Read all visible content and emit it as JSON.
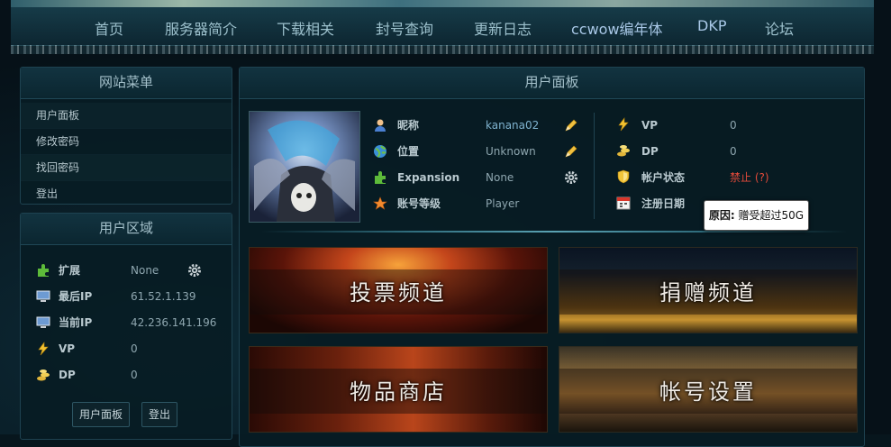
{
  "nav": [
    "首页",
    "服务器简介",
    "下载相关",
    "封号查询",
    "更新日志",
    "ccwow编年体",
    "DKP",
    "论坛"
  ],
  "site_menu": {
    "title": "网站菜单",
    "items": [
      "用户面板",
      "修改密码",
      "找回密码",
      "登出"
    ]
  },
  "user_area": {
    "title": "用户区域",
    "rows": [
      {
        "label": "扩展",
        "value": "None",
        "icon": "puzzle-icon"
      },
      {
        "label": "最后IP",
        "value": "61.52.1.139",
        "icon": "computer-icon"
      },
      {
        "label": "当前IP",
        "value": "42.236.141.196",
        "icon": "computer-icon"
      },
      {
        "label": "VP",
        "value": "0",
        "icon": "lightning-icon"
      },
      {
        "label": "DP",
        "value": "0",
        "icon": "coins-icon"
      }
    ],
    "buttons": [
      "用户面板",
      "登出"
    ]
  },
  "user_panel": {
    "title": "用户面板",
    "left_rows": [
      {
        "label": "昵称",
        "value": "kanana02",
        "icon": "user-icon"
      },
      {
        "label": "位置",
        "value": "Unknown",
        "icon": "globe-icon"
      },
      {
        "label": "Expansion",
        "value": "None",
        "icon": "puzzle-icon"
      },
      {
        "label": "账号等级",
        "value": "Player",
        "icon": "star-icon"
      }
    ],
    "right_rows": [
      {
        "label": "VP",
        "value": "0",
        "icon": "lightning-icon"
      },
      {
        "label": "DP",
        "value": "0",
        "icon": "coins-icon"
      },
      {
        "label": "帐户状态",
        "value": "禁止 (?)",
        "icon": "shield-icon"
      },
      {
        "label": "注册日期",
        "value": "",
        "icon": "calendar-icon"
      }
    ]
  },
  "tooltip": {
    "prefix": "原因:",
    "text": " 赠受超过50G"
  },
  "banners": [
    "投票频道",
    "捐赠频道",
    "物品商店",
    "帐号设置"
  ],
  "colors": {
    "accent": "#7fb3cf",
    "status_red": "#e24a3a",
    "nav_highlight": "#a8c7e6"
  }
}
